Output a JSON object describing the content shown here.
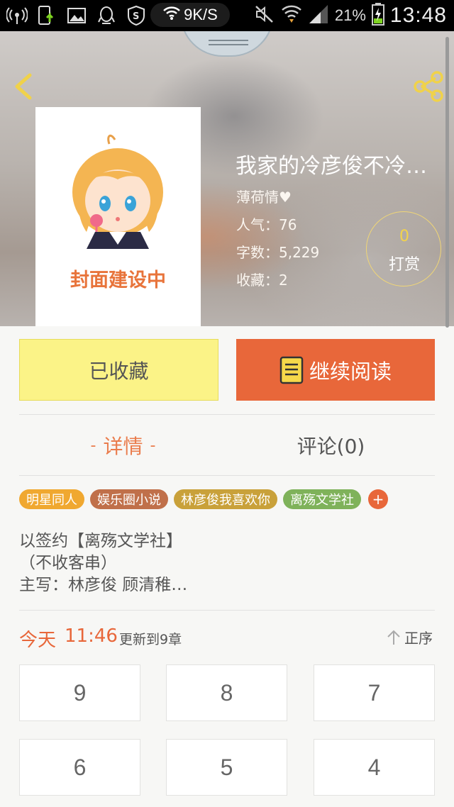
{
  "status_bar": {
    "net_speed": "9K/S",
    "battery_percent": "21%",
    "time": "13:48"
  },
  "book": {
    "cover_text": "封面建设中",
    "title": "我家的冷彦俊不冷…",
    "author": "薄荷情♥",
    "popularity": "人气：76",
    "word_count": "字数：5,229",
    "favorites": "收藏：2"
  },
  "reward": {
    "count": "0",
    "label": "打赏"
  },
  "actions": {
    "favorited_label": "已收藏",
    "continue_label": "继续阅读"
  },
  "tabs": {
    "details": "详情",
    "details_dash": "-",
    "comments": "评论(0)"
  },
  "tags": [
    {
      "label": "明星同人",
      "color": "#f0a830"
    },
    {
      "label": "娱乐圈小说",
      "color": "#c0704a"
    },
    {
      "label": "林彦俊我喜欢你",
      "color": "#c9a13a"
    },
    {
      "label": "离殇文学社",
      "color": "#7fb25a"
    }
  ],
  "tag_add": "+",
  "description": [
    "以签约【离殇文学社】",
    "（不收客串）",
    "主写：林彦俊  顾清稚…"
  ],
  "update": {
    "day": "今天",
    "time": "11:46",
    "info": "更新到9章"
  },
  "sort": {
    "label": "正序"
  },
  "chapters": [
    "9",
    "8",
    "7",
    "6",
    "5",
    "4"
  ],
  "colors": {
    "accent": "#e8673a",
    "favorited_bg": "#fbf387",
    "reward_gold": "#f3d34a"
  }
}
